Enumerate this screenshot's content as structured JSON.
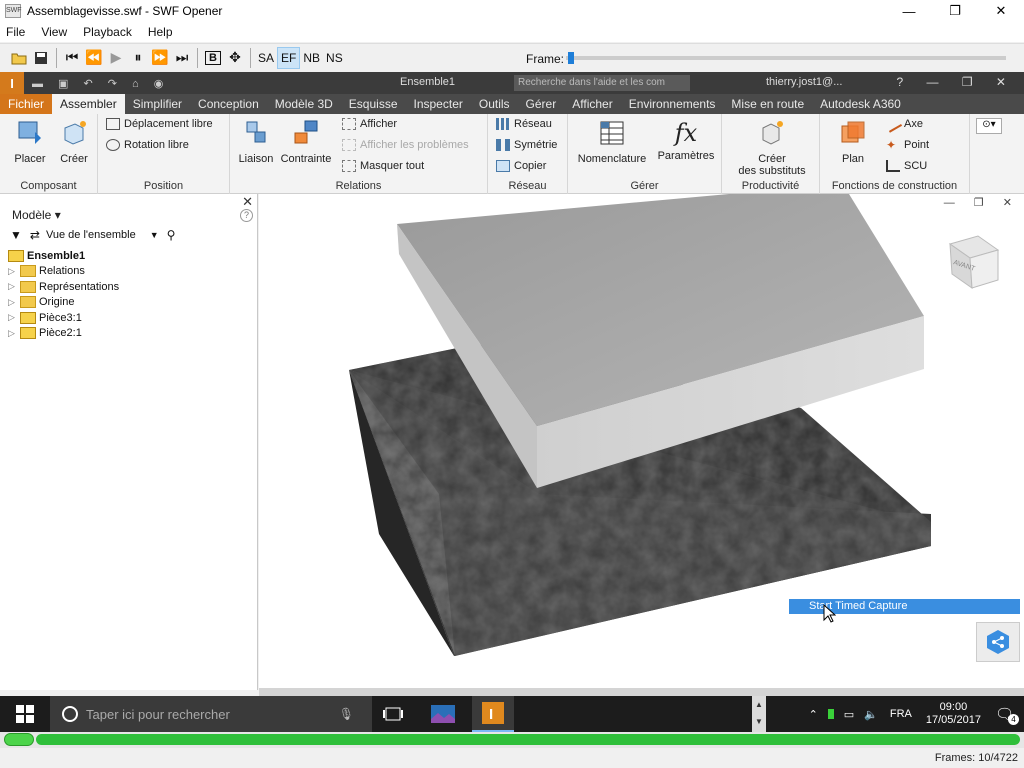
{
  "window": {
    "title": "Assemblagevisse.swf - SWF Opener",
    "app_icon": "SWF",
    "minimize": "—",
    "maximize": "❐",
    "close": "✕"
  },
  "menubar": [
    "File",
    "View",
    "Playback",
    "Help"
  ],
  "swf_toolbar": {
    "buttons": [
      "SA",
      "EF",
      "NB",
      "NS"
    ],
    "b_label": "B",
    "frame_label": "Frame:",
    "frame_progress": 0.01
  },
  "inventor": {
    "logo": "I",
    "document": "Ensemble1",
    "search_placeholder": "Recherche dans l'aide et les com",
    "user": "thierry.jost1@...",
    "tabs": [
      "Fichier",
      "Assembler",
      "Simplifier",
      "Conception",
      "Modèle 3D",
      "Esquisse",
      "Inspecter",
      "Outils",
      "Gérer",
      "Afficher",
      "Environnements",
      "Mise en route",
      "Autodesk A360"
    ],
    "active_tab": "Assembler",
    "ribbon": {
      "composant": {
        "label": "Composant",
        "placer": "Placer",
        "creer": "Créer"
      },
      "position": {
        "label": "Position",
        "deplacement": "Déplacement libre",
        "rotation": "Rotation libre"
      },
      "relations": {
        "label": "Relations",
        "liaison": "Liaison",
        "contrainte": "Contrainte",
        "afficher": "Afficher",
        "afficher_problemes": "Afficher les problèmes",
        "masquer": "Masquer tout"
      },
      "reseau": {
        "label": "Réseau",
        "reseau": "Réseau",
        "symetrie": "Symétrie",
        "copier": "Copier"
      },
      "gerer": {
        "label": "Gérer",
        "nomenclature": "Nomenclature",
        "parametres": "Paramètres",
        "fx": "fx"
      },
      "productivite": {
        "label": "Productivité",
        "creer": "Créer",
        "substituts": "des substituts"
      },
      "construction": {
        "label": "Fonctions de construction",
        "plan": "Plan",
        "axe": "Axe",
        "point": "Point",
        "scu": "SCU"
      }
    }
  },
  "browser": {
    "title": "Modèle",
    "view": "Vue de l'ensemble",
    "tree": [
      {
        "label": "Ensemble1",
        "bold": true,
        "type": "assembly"
      },
      {
        "label": "Relations",
        "type": "folder"
      },
      {
        "label": "Représentations",
        "type": "folder"
      },
      {
        "label": "Origine",
        "type": "folder"
      },
      {
        "label": "Pièce3:1",
        "type": "part"
      },
      {
        "label": "Pièce2:1",
        "type": "part"
      }
    ]
  },
  "viewcube": {
    "face": "AVANT"
  },
  "popup": {
    "label": "Start Timed Capture"
  },
  "taskbar": {
    "search_placeholder": "Taper ici pour rechercher",
    "lang": "FRA",
    "time": "09:00",
    "date": "17/05/2017",
    "notifications": "4"
  },
  "footer": {
    "frames": "Frames: 10/4722"
  },
  "colors": {
    "accent": "#d4751a",
    "selection": "#3a8ee0",
    "progress": "#2fbf3a"
  }
}
